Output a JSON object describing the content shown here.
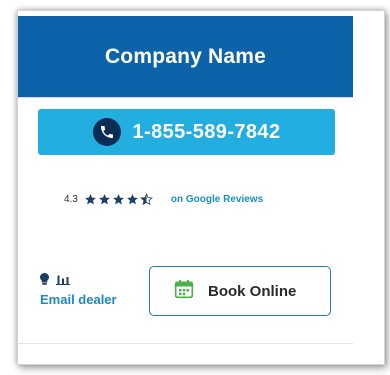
{
  "colors": {
    "header_bg": "#0d63a9",
    "phone_bg": "#23aee0",
    "phone_icon_bg": "#0a2d55",
    "link": "#1b8fc4",
    "book_border": "#1d7fa8",
    "calendar_icon": "#4cae4c"
  },
  "header": {
    "title": "Company Name"
  },
  "phone": {
    "number": "1-855-589-7842",
    "icon": "phone-icon"
  },
  "rating": {
    "value_label": "4.3",
    "value": 4.3,
    "max": 5,
    "source_label": "on Google Reviews"
  },
  "dealer": {
    "email_label": "Email dealer",
    "icons": [
      "lightbulb-icon",
      "bar-chart-icon"
    ]
  },
  "booking": {
    "label": "Book Online",
    "icon": "calendar-icon"
  }
}
